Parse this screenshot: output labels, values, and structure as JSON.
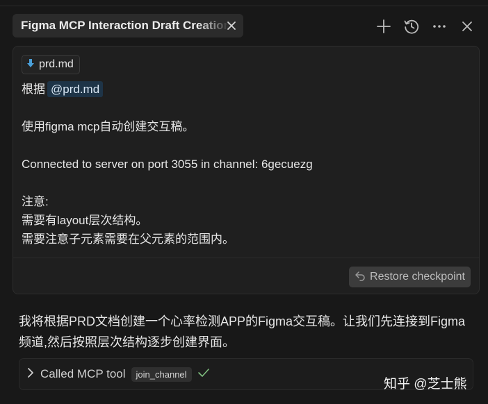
{
  "tab": {
    "title": "Figma MCP Interaction Draft Creation"
  },
  "toolbar": {
    "icons": [
      "plus-icon",
      "history-icon",
      "more-icon",
      "close-icon"
    ]
  },
  "user_message": {
    "attachment": {
      "icon": "download-arrow-icon",
      "name": "prd.md"
    },
    "line1_prefix": "根据",
    "line1_mention": "@prd.md",
    "line2": "使用figma mcp自动创建交互稿。",
    "line3": "Connected to server on port 3055 in channel: 6gecuezg",
    "line4": "注意:",
    "line5": "需要有layout层次结构。",
    "line6": "需要注意子元素需要在父元素的范围内。",
    "restore_label": "Restore checkpoint"
  },
  "assistant_reply": {
    "text": "我将根据PRD文档创建一个心率检测APP的Figma交互稿。让我们先连接到Figma频道,然后按照层次结构逐步创建界面。"
  },
  "tool_call": {
    "label": "Called MCP tool",
    "tool_name": "join_channel",
    "status": "success"
  },
  "watermark": "知乎 @芝士熊",
  "colors": {
    "background": "#181818",
    "card": "#1f1f1f",
    "mention_bg": "#1e3447",
    "attachment_icon": "#4a9fd8",
    "success": "#7fbf7f"
  }
}
